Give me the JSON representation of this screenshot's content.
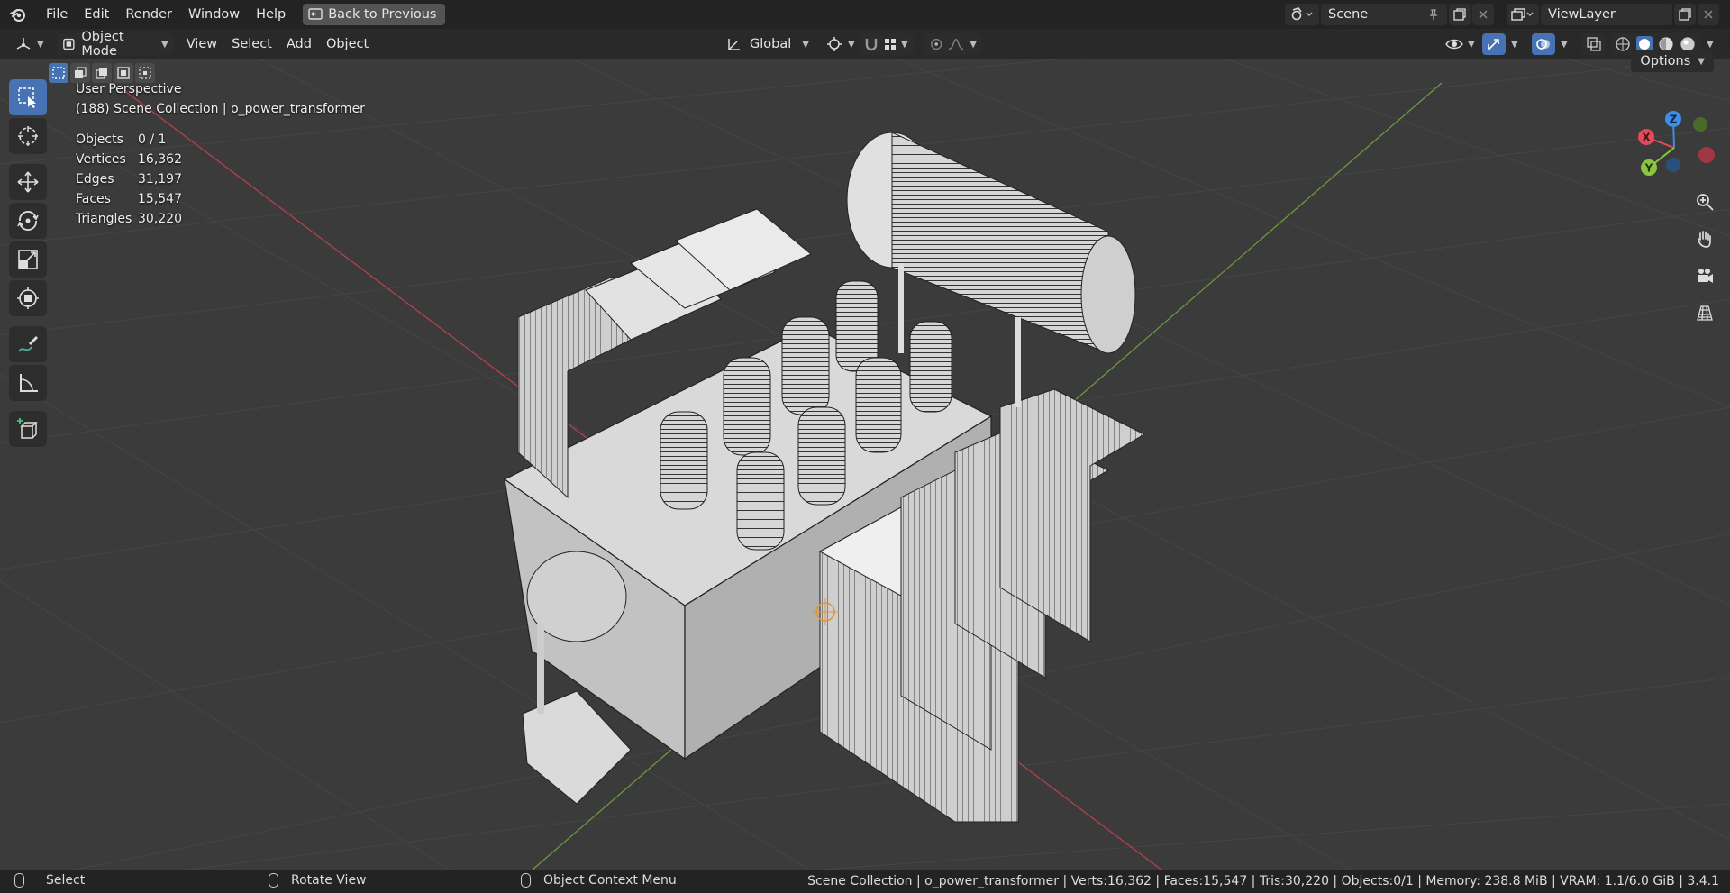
{
  "topbar": {
    "menus": [
      "File",
      "Edit",
      "Render",
      "Window",
      "Help"
    ],
    "back_button": "Back to Previous",
    "scene_name": "Scene",
    "view_layer_name": "ViewLayer"
  },
  "viewport_header": {
    "mode": "Object Mode",
    "menus": [
      "View",
      "Select",
      "Add",
      "Object"
    ],
    "transform_orientation": "Global",
    "options_label": "Options"
  },
  "overlay": {
    "perspective": "User Perspective",
    "collection_info": "(188) Scene Collection | o_power_transformer",
    "stats": [
      {
        "label": "Objects",
        "value": "0 / 1"
      },
      {
        "label": "Vertices",
        "value": "16,362"
      },
      {
        "label": "Edges",
        "value": "31,197"
      },
      {
        "label": "Faces",
        "value": "15,547"
      },
      {
        "label": "Triangles",
        "value": "30,220"
      }
    ]
  },
  "gizmo": {
    "x_label": "X",
    "y_label": "Y",
    "z_label": "Z",
    "colors": {
      "x": "#e44a59",
      "y": "#8cc63f",
      "z": "#3d8ee8"
    }
  },
  "toolbar": {
    "tools": [
      "select-box",
      "cursor",
      "move",
      "rotate",
      "scale",
      "transform",
      "annotate",
      "measure",
      "add-cube"
    ]
  },
  "statusbar": {
    "hint_left": "Select",
    "hint_middle": "Rotate View",
    "hint_right": "Object Context Menu",
    "stats": "Scene Collection | o_power_transformer | Verts:16,362 | Faces:15,547 | Tris:30,220 | Objects:0/1 | Memory: 238.8 MiB | VRAM: 1.1/6.0 GiB | 3.4.1"
  }
}
